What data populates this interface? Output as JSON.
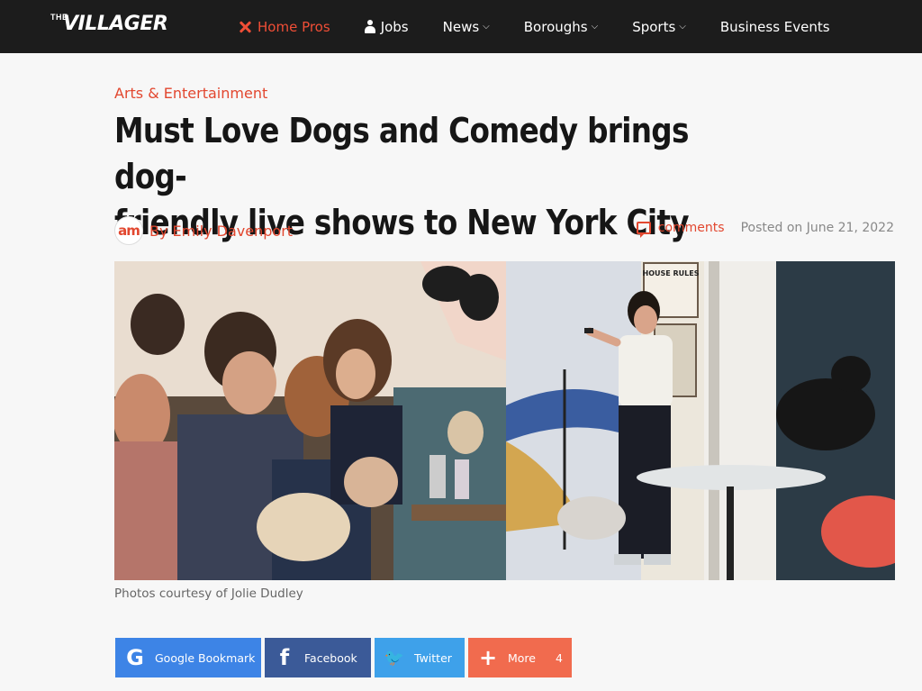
{
  "site": {
    "logo_prefix": "THE",
    "logo_name": "VILLAGER"
  },
  "nav": {
    "items": [
      {
        "label": "Home Pros",
        "icon": "tools-icon",
        "active": true
      },
      {
        "label": "Jobs",
        "icon": "user-icon"
      },
      {
        "label": "News",
        "dropdown": true
      },
      {
        "label": "Boroughs",
        "dropdown": true
      },
      {
        "label": "Sports",
        "dropdown": true
      },
      {
        "label": "Business Events"
      }
    ],
    "chevron": "⌵"
  },
  "article": {
    "category": "Arts & Entertainment",
    "headline_line1": "Must Love Dogs and Comedy brings dog-",
    "headline_line2": "friendly live shows to New York City",
    "author_avatar_text": "am",
    "author": "By Emily Davenport",
    "comments_label": "comments",
    "posted": "Posted on June 21, 2022",
    "caption": "Photos courtesy of Jolie Dudley",
    "photo_sign": "HOUSE RULES"
  },
  "share": {
    "google": "Google Bookmark",
    "google_glyph": "G",
    "facebook": "Facebook",
    "facebook_glyph": "f",
    "twitter": "Twitter",
    "twitter_glyph": "🐦",
    "more": "More",
    "more_glyph": "+",
    "more_count": "4"
  },
  "colors": {
    "accent": "#e2472f",
    "nav_bg": "#1c1c1c",
    "google": "#3d84e6",
    "facebook": "#3b5a98",
    "twitter": "#3ea1ea",
    "more": "#f16b4e"
  }
}
